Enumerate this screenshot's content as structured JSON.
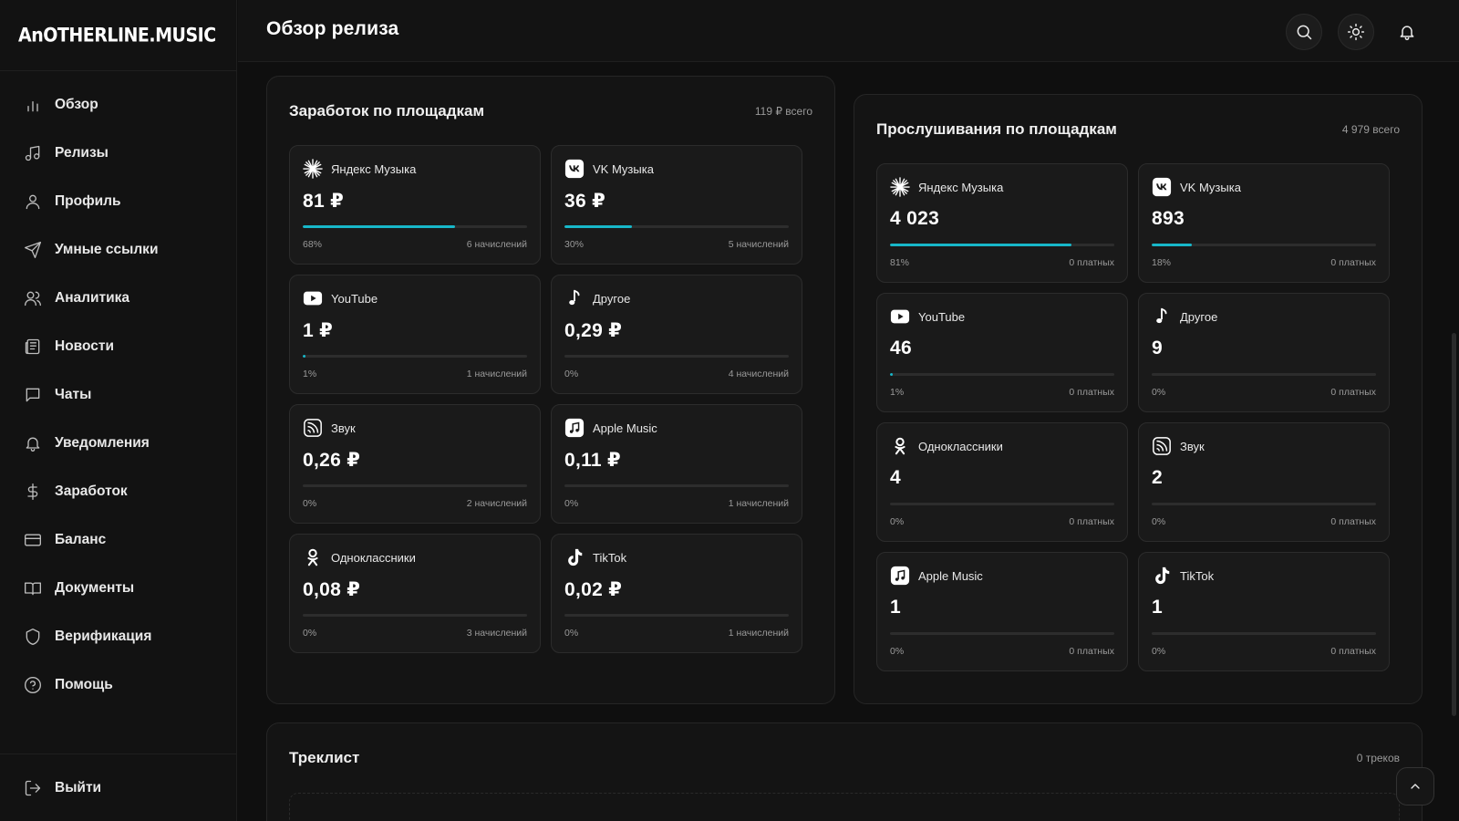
{
  "app": {
    "logo": "AnOTHERLINE.MUSIC",
    "accent": "#17b7c9"
  },
  "header": {
    "title": "Обзор релиза"
  },
  "sidebar": {
    "items": [
      {
        "label": "Обзор",
        "icon": "bar-chart-icon"
      },
      {
        "label": "Релизы",
        "icon": "music-note-icon"
      },
      {
        "label": "Профиль",
        "icon": "user-icon"
      },
      {
        "label": "Умные ссылки",
        "icon": "send-icon"
      },
      {
        "label": "Аналитика",
        "icon": "users-icon"
      },
      {
        "label": "Новости",
        "icon": "newspaper-icon"
      },
      {
        "label": "Чаты",
        "icon": "chat-icon"
      },
      {
        "label": "Уведомления",
        "icon": "bell-icon"
      },
      {
        "label": "Заработок",
        "icon": "dollar-icon"
      },
      {
        "label": "Баланс",
        "icon": "credit-card-icon"
      },
      {
        "label": "Документы",
        "icon": "book-icon"
      },
      {
        "label": "Верификация",
        "icon": "shield-icon"
      },
      {
        "label": "Помощь",
        "icon": "help-icon"
      }
    ],
    "logout": "Выйти"
  },
  "earnings": {
    "title": "Заработок по площадкам",
    "total": "119 ₽ всего",
    "cards": [
      {
        "platform": "Яндекс Музыка",
        "icon": "yandex-icon",
        "value": "81 ₽",
        "percent": "68%",
        "progress": 0.68,
        "sub": "6 начислений"
      },
      {
        "platform": "VK Музыка",
        "icon": "vk-icon",
        "value": "36 ₽",
        "percent": "30%",
        "progress": 0.3,
        "sub": "5 начислений"
      },
      {
        "platform": "YouTube",
        "icon": "youtube-icon",
        "value": "1 ₽",
        "percent": "1%",
        "progress": 0.01,
        "sub": "1 начислений"
      },
      {
        "platform": "Другое",
        "icon": "music-note-icon",
        "value": "0,29 ₽",
        "percent": "0%",
        "progress": 0,
        "sub": "4 начислений"
      },
      {
        "platform": "Звук",
        "icon": "zvuk-icon",
        "value": "0,26 ₽",
        "percent": "0%",
        "progress": 0,
        "sub": "2 начислений"
      },
      {
        "platform": "Apple Music",
        "icon": "apple-music-icon",
        "value": "0,11 ₽",
        "percent": "0%",
        "progress": 0,
        "sub": "1 начислений"
      },
      {
        "platform": "Одноклассники",
        "icon": "ok-icon",
        "value": "0,08 ₽",
        "percent": "0%",
        "progress": 0,
        "sub": "3 начислений"
      },
      {
        "platform": "TikTok",
        "icon": "tiktok-icon",
        "value": "0,02 ₽",
        "percent": "0%",
        "progress": 0,
        "sub": "1 начислений"
      }
    ]
  },
  "streams": {
    "title": "Прослушивания по площадкам",
    "total": "4 979 всего",
    "cards": [
      {
        "platform": "Яндекс Музыка",
        "icon": "yandex-icon",
        "value": "4 023",
        "percent": "81%",
        "progress": 0.81,
        "sub": "0 платных"
      },
      {
        "platform": "VK Музыка",
        "icon": "vk-icon",
        "value": "893",
        "percent": "18%",
        "progress": 0.18,
        "sub": "0 платных"
      },
      {
        "platform": "YouTube",
        "icon": "youtube-icon",
        "value": "46",
        "percent": "1%",
        "progress": 0.01,
        "sub": "0 платных"
      },
      {
        "platform": "Другое",
        "icon": "music-note-icon",
        "value": "9",
        "percent": "0%",
        "progress": 0,
        "sub": "0 платных"
      },
      {
        "platform": "Одноклассники",
        "icon": "ok-icon",
        "value": "4",
        "percent": "0%",
        "progress": 0,
        "sub": "0 платных"
      },
      {
        "platform": "Звук",
        "icon": "zvuk-icon",
        "value": "2",
        "percent": "0%",
        "progress": 0,
        "sub": "0 платных"
      },
      {
        "platform": "Apple Music",
        "icon": "apple-music-icon",
        "value": "1",
        "percent": "0%",
        "progress": 0,
        "sub": "0 платных"
      },
      {
        "platform": "TikTok",
        "icon": "tiktok-icon",
        "value": "1",
        "percent": "0%",
        "progress": 0,
        "sub": "0 платных"
      }
    ]
  },
  "tracklist": {
    "title": "Треклист",
    "count": "0 треков"
  }
}
